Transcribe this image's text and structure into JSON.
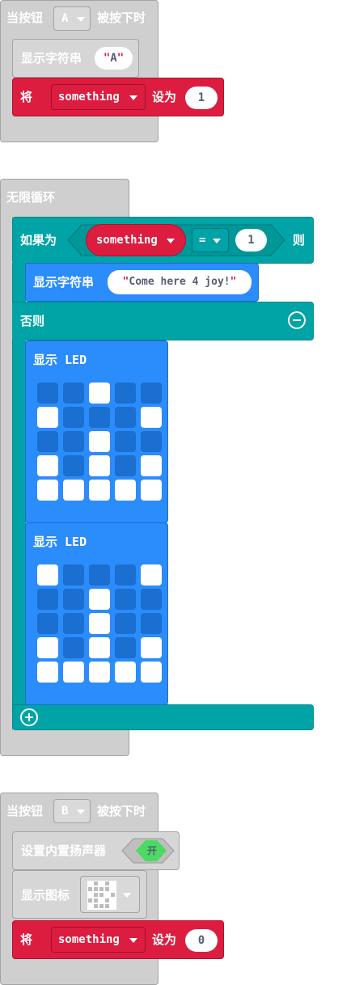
{
  "block1": {
    "hat_prefix": "当按钮",
    "button_value": "A",
    "hat_suffix": "被按下时",
    "show_string_label": "显示字符串",
    "show_string_value": "A",
    "set_label": "将",
    "variable": "something",
    "set_to_label": "设为",
    "set_value": "1"
  },
  "block2": {
    "forever_label": "无限循环",
    "if_label": "如果为",
    "variable": "something",
    "operator": "=",
    "compare_value": "1",
    "then_label": "则",
    "show_string_label": "显示字符串",
    "show_string_value": "Come here 4 joy!",
    "else_label": "否则",
    "show_led_label_1": "显示 LED",
    "show_led_label_2": "显示 LED",
    "led_grid_1": [
      [
        0,
        0,
        1,
        0,
        0
      ],
      [
        1,
        0,
        0,
        0,
        1
      ],
      [
        0,
        0,
        1,
        0,
        0
      ],
      [
        1,
        0,
        1,
        0,
        1
      ],
      [
        1,
        1,
        1,
        1,
        1
      ]
    ],
    "led_grid_2": [
      [
        1,
        0,
        0,
        0,
        1
      ],
      [
        0,
        0,
        1,
        0,
        0
      ],
      [
        0,
        0,
        1,
        0,
        0
      ],
      [
        1,
        0,
        1,
        0,
        1
      ],
      [
        1,
        1,
        1,
        1,
        1
      ]
    ]
  },
  "block3": {
    "hat_prefix": "当按钮",
    "button_value": "B",
    "hat_suffix": "被按下时",
    "speaker_label": "设置内置扬声器",
    "speaker_toggle": "开",
    "show_icon_label": "显示图标",
    "set_label": "将",
    "variable": "something",
    "set_to_label": "设为",
    "set_value": "0"
  },
  "colors": {
    "event_gray": "#cfcfcf",
    "variables_red": "#dc1d40",
    "logic_teal": "#00a4a6",
    "basic_blue": "#2b8cfb",
    "led_off": "#1a6fd0",
    "toggle_green": "#4cd964"
  }
}
